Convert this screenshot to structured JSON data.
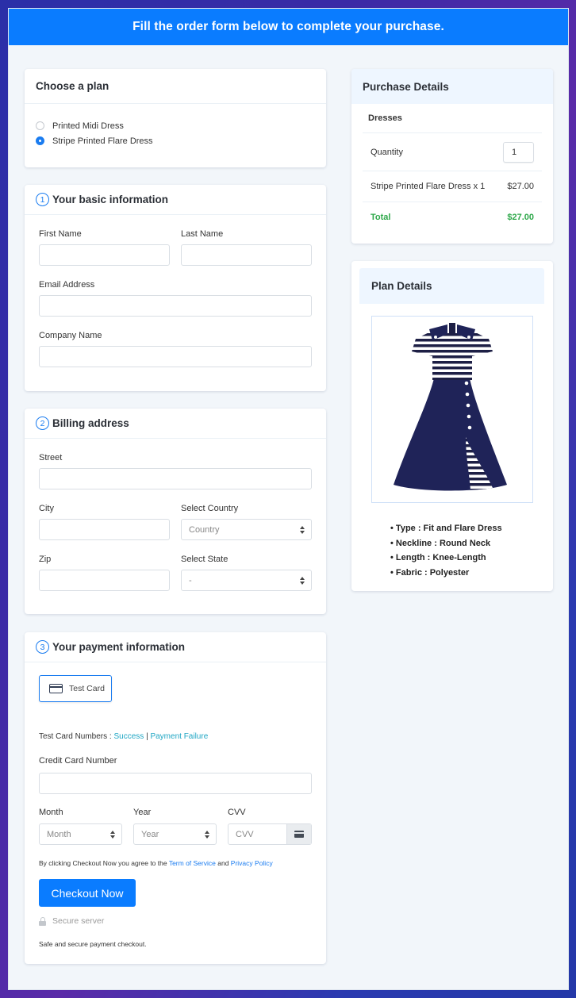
{
  "banner": {
    "text": "Fill the order form below to complete your purchase."
  },
  "plan": {
    "title": "Choose a plan",
    "options": [
      {
        "label": "Printed Midi Dress",
        "selected": false
      },
      {
        "label": "Stripe Printed Flare Dress",
        "selected": true
      }
    ]
  },
  "basic_info": {
    "step": "1",
    "title": "Your basic information",
    "first_name_label": "First Name",
    "first_name_value": "",
    "last_name_label": "Last Name",
    "last_name_value": "",
    "email_label": "Email Address",
    "email_value": "",
    "company_label": "Company Name",
    "company_value": ""
  },
  "billing": {
    "step": "2",
    "title": "Billing address",
    "street_label": "Street",
    "street_value": "",
    "city_label": "City",
    "city_value": "",
    "country_label": "Select Country",
    "country_value": "Country",
    "zip_label": "Zip",
    "zip_value": "",
    "state_label": "Select State",
    "state_value": "-"
  },
  "payment": {
    "step": "3",
    "title": "Your payment information",
    "method_label": "Test Card",
    "test_numbers_label": "Test Card Numbers :",
    "success_link": "Success",
    "separator": "|",
    "failure_link": "Payment Failure",
    "card_number_label": "Credit Card Number",
    "card_number_value": "",
    "month_label": "Month",
    "month_value": "Month",
    "year_label": "Year",
    "year_value": "Year",
    "cvv_label": "CVV",
    "cvv_placeholder": "CVV",
    "terms_prefix": "By clicking Checkout Now you agree to the",
    "terms_link": "Term of Service",
    "terms_and": "and",
    "privacy_link": "Privacy Policy",
    "checkout_button": "Checkout Now",
    "secure_label": "Secure server",
    "safe_note": "Safe and secure payment checkout."
  },
  "purchase": {
    "title": "Purchase Details",
    "category": "Dresses",
    "quantity_label": "Quantity",
    "quantity_value": "1",
    "line_item": "Stripe Printed Flare Dress x 1",
    "line_price": "$27.00",
    "total_label": "Total",
    "total_value": "$27.00",
    "total_color": "#2ea84a"
  },
  "plan_details": {
    "title": "Plan Details",
    "image_alt": "Navy stripe printed flare dress",
    "specs": [
      "Type : Fit and Flare Dress",
      "Neckline : Round Neck",
      "Length : Knee-Length",
      "Fabric : Polyester"
    ]
  },
  "colors": {
    "accent": "#0a7cff",
    "link": "#1fa6c4",
    "background": "#f2f6fa"
  }
}
